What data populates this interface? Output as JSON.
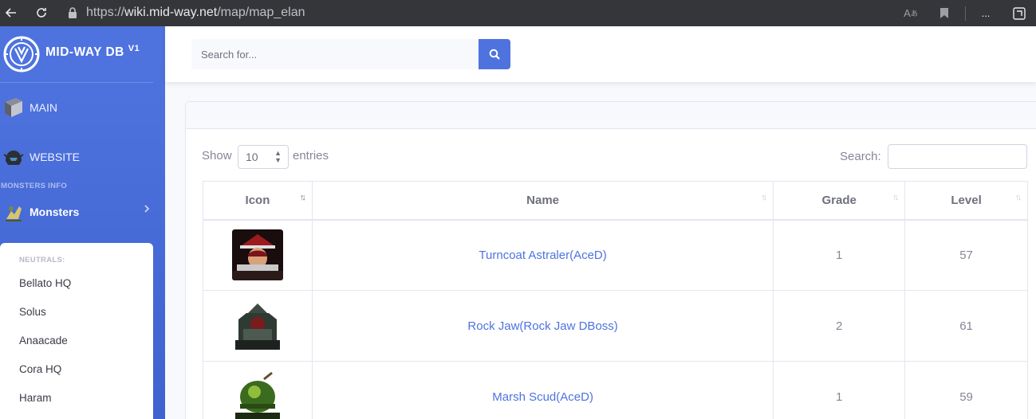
{
  "browser": {
    "url_prefix": "https://",
    "url_domain": "wiki.mid-way.net",
    "url_path": "/map/map_elan",
    "read_aloud": "A",
    "more_label": "..."
  },
  "sidebar": {
    "brand": "MID-WAY DB",
    "brand_version": "V1",
    "main_label": "MAIN",
    "website_label": "WEBSITE",
    "heading": "MONSTERS INFO",
    "monsters_label": "Monsters",
    "collapse_header": "NEUTRALS:",
    "collapse_items": [
      "Bellato HQ",
      "Solus",
      "Anaacade",
      "Cora HQ",
      "Haram"
    ]
  },
  "topbar": {
    "search_placeholder": "Search for..."
  },
  "table_controls": {
    "show_label": "Show",
    "entries_value": "10",
    "entries_label": "entries",
    "search_label": "Search:"
  },
  "table": {
    "columns": [
      "Icon",
      "Name",
      "Grade",
      "Level"
    ],
    "rows": [
      {
        "icon": "monster-portrait-icon",
        "name": "Turncoat Astraler(AceD)",
        "grade": "1",
        "level": "57",
        "color": "#7a1418"
      },
      {
        "icon": "monster-portrait-icon",
        "name": "Rock Jaw(Rock Jaw DBoss)",
        "grade": "2",
        "level": "61",
        "color": "#2f3a33"
      },
      {
        "icon": "monster-portrait-icon",
        "name": "Marsh Scud(AceD)",
        "grade": "1",
        "level": "59",
        "color": "#3b6b1e"
      }
    ]
  },
  "colors": {
    "primary": "#4e73df",
    "text_muted": "#858796",
    "browser_bar": "#35363a"
  }
}
